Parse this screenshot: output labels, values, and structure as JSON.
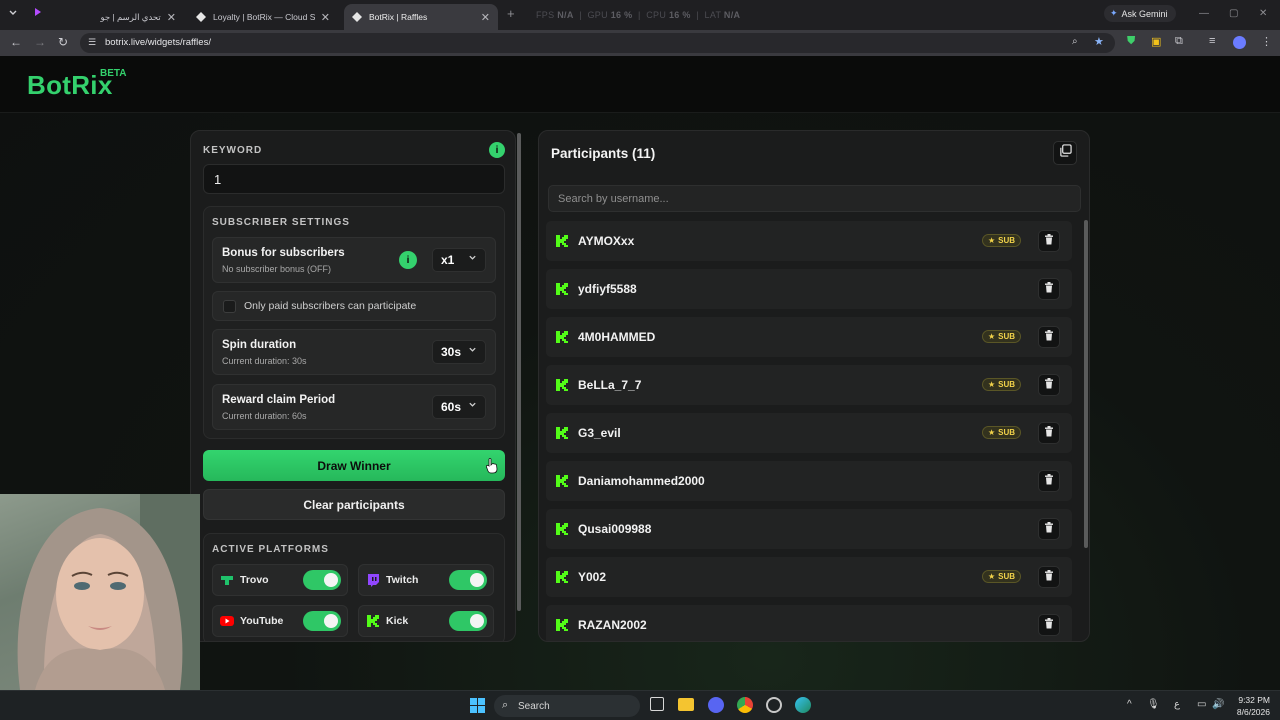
{
  "browser": {
    "tabs": [
      {
        "title": "تحدي الرسم | جولة"
      },
      {
        "title": "Loyalty | BotRix — Cloud Stream"
      },
      {
        "title": "BotRix | Raffles"
      }
    ],
    "perf": {
      "fps_label": "FPS",
      "fps": "N/A",
      "gpu_label": "GPU",
      "gpu": "16 %",
      "cpu_label": "CPU",
      "cpu": "16 %",
      "lat_label": "LAT",
      "lat": "N/A"
    },
    "gemini_label": "Ask Gemini",
    "url": "botrix.live/widgets/raffles/"
  },
  "site": {
    "logo": "BotRix",
    "beta": "BETA"
  },
  "raffle": {
    "keyword_label": "KEYWORD",
    "keyword_value": "1",
    "info_glyph": "i",
    "subscriber_settings_label": "SUBSCRIBER SETTINGS",
    "bonus": {
      "title": "Bonus for subscribers",
      "sub": "No subscriber bonus (OFF)",
      "value": "x1"
    },
    "paid_only_label": "Only paid subscribers can participate",
    "paid_only_checked": false,
    "spin": {
      "title": "Spin duration",
      "sub": "Current duration: 30s",
      "value": "30s"
    },
    "claim": {
      "title": "Reward claim Period",
      "sub": "Current duration: 60s",
      "value": "60s"
    },
    "draw_button": "Draw Winner",
    "clear_button": "Clear participants",
    "active_platforms_label": "ACTIVE PLATFORMS",
    "platforms": [
      {
        "name": "Trovo",
        "enabled": true,
        "color": "#1fc26b"
      },
      {
        "name": "Twitch",
        "enabled": true,
        "color": "#9146ff"
      },
      {
        "name": "YouTube",
        "enabled": true,
        "color": "#ff0000"
      },
      {
        "name": "Kick",
        "enabled": true,
        "color": "#53fc18"
      }
    ]
  },
  "participants": {
    "title": "Participants (11)",
    "search_placeholder": "Search by username...",
    "sub_badge": "SUB",
    "list": [
      {
        "name": "AYMOXxx",
        "sub": true
      },
      {
        "name": "ydfiyf5588",
        "sub": false
      },
      {
        "name": "4M0HAMMED",
        "sub": true
      },
      {
        "name": "BeLLa_7_7",
        "sub": true
      },
      {
        "name": "G3_evil",
        "sub": true
      },
      {
        "name": "Daniamohammed2000",
        "sub": false
      },
      {
        "name": "Qusai009988",
        "sub": false
      },
      {
        "name": "Y002",
        "sub": true
      },
      {
        "name": "RAZAN2002",
        "sub": false
      }
    ]
  },
  "taskbar": {
    "search_label": "Search",
    "time": "9:32 PM",
    "date": "8/6/2026",
    "ime": "ع"
  },
  "colors": {
    "accent": "#34d16d",
    "sub_gold": "#f1d24a",
    "bg": "#0f1110"
  }
}
